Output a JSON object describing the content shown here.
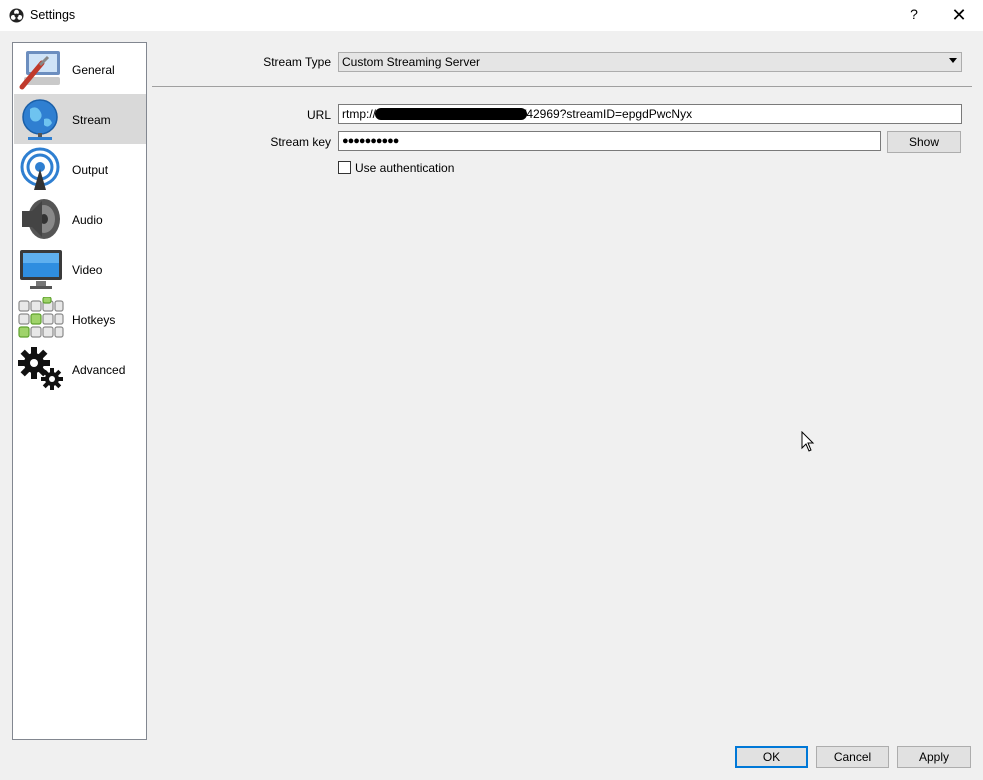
{
  "window": {
    "title": "Settings",
    "help_label": "?",
    "close_label": "✕"
  },
  "sidebar": {
    "items": [
      {
        "label": "General",
        "icon": "general-icon"
      },
      {
        "label": "Stream",
        "icon": "stream-globe-icon",
        "active": true
      },
      {
        "label": "Output",
        "icon": "output-broadcast-icon"
      },
      {
        "label": "Audio",
        "icon": "speaker-icon"
      },
      {
        "label": "Video",
        "icon": "monitor-icon"
      },
      {
        "label": "Hotkeys",
        "icon": "keyboard-icon"
      },
      {
        "label": "Advanced",
        "icon": "gears-icon"
      }
    ]
  },
  "stream": {
    "type_label": "Stream Type",
    "type_value": "Custom Streaming Server",
    "url_label": "URL",
    "url_prefix": "rtmp://",
    "url_suffix": "/42969?streamID=epgdPwcNyx",
    "key_label": "Stream key",
    "key_value": "●●●●●●●●●●",
    "show_label": "Show",
    "auth_label": "Use authentication",
    "auth_checked": false
  },
  "footer": {
    "ok_label": "OK",
    "cancel_label": "Cancel",
    "apply_label": "Apply"
  }
}
